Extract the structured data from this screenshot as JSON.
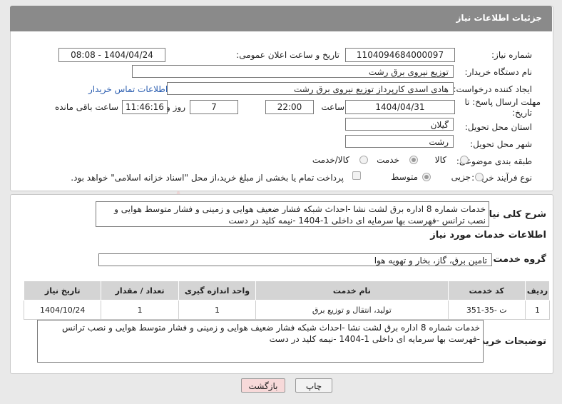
{
  "header": {
    "title": "جزئیات اطلاعات نیاز"
  },
  "form": {
    "need_number_label": "شماره نیاز:",
    "need_number": "1104094684000097",
    "announce_label": "تاریخ و ساعت اعلان عمومی:",
    "announce_value": "1404/04/24 - 08:08",
    "buyer_label": "نام دستگاه خریدار:",
    "buyer_value": "توزیع نیروی برق رشت",
    "creator_label": "ایجاد کننده درخواست:",
    "creator_value": "هادی  اسدی کارپرداز توزیع نیروی برق رشت",
    "contact_link": "اطلاعات تماس خریدار",
    "deadline_label_1": "مهلت ارسال پاسخ: تا",
    "deadline_label_2": "تاریخ:",
    "deadline_date": "1404/04/31",
    "time_label": "ساعت",
    "deadline_time": "22:00",
    "days_value": "7",
    "days_label": "روز و",
    "remaining_time": "11:46:16",
    "remaining_label": "ساعت باقی مانده",
    "province_label": "استان محل تحویل:",
    "province_value": "گیلان",
    "city_label": "شهر محل تحویل:",
    "city_value": "رشت",
    "category_label": "طبقه بندی موضوعی:",
    "category_options": [
      "کالا",
      "خدمت",
      "کالا/خدمت"
    ],
    "category_selected": "خدمت",
    "process_label": "نوع فرآیند خرید :",
    "process_options": [
      "جزیی",
      "متوسط"
    ],
    "process_selected": "متوسط",
    "payment_note": "پرداخت تمام یا بخشی از مبلغ خرید،از محل \"اسناد خزانه اسلامی\" خواهد بود."
  },
  "summary": {
    "label": "شرح کلی نیاز:",
    "text": "خدمات شماره 8 اداره برق لشت نشا -احداث شبکه فشار ضعیف هوایی و زمینی و فشار متوسط هوایی و نصب ترانس -فهرست بها سرمایه ای داخلی 1-1404 -نیمه کلید در دست"
  },
  "services": {
    "section_title": "اطلاعات خدمات مورد نیاز",
    "group_label": "گروه خدمت:",
    "group_value": "تامین برق، گاز، بخار و تهویه هوا",
    "columns": [
      "ردیف",
      "کد خدمت",
      "نام خدمت",
      "واحد اندازه گیری",
      "تعداد / مقدار",
      "تاریخ نیاز"
    ],
    "rows": [
      [
        "1",
        "ت -35-351",
        "تولید، انتقال و توزیع برق",
        "1",
        "1",
        "1404/10/24"
      ]
    ]
  },
  "buyer_notes": {
    "label": "توضیحات خریدار:",
    "text": "خدمات شماره 8 اداره برق لشت نشا -احداث شبکه فشار ضعیف هوایی و زمینی و فشار متوسط هوایی و نصب ترانس -فهرست بها سرمایه ای داخلی 1-1404 -نیمه کلید در دست"
  },
  "buttons": {
    "print": "چاپ",
    "back": "بازگشت"
  },
  "colors": {
    "header_bg": "#8a8a8a",
    "link": "#2a5db0",
    "back_bg": "#f7d9d9",
    "watermark": "#e8b0b0"
  }
}
